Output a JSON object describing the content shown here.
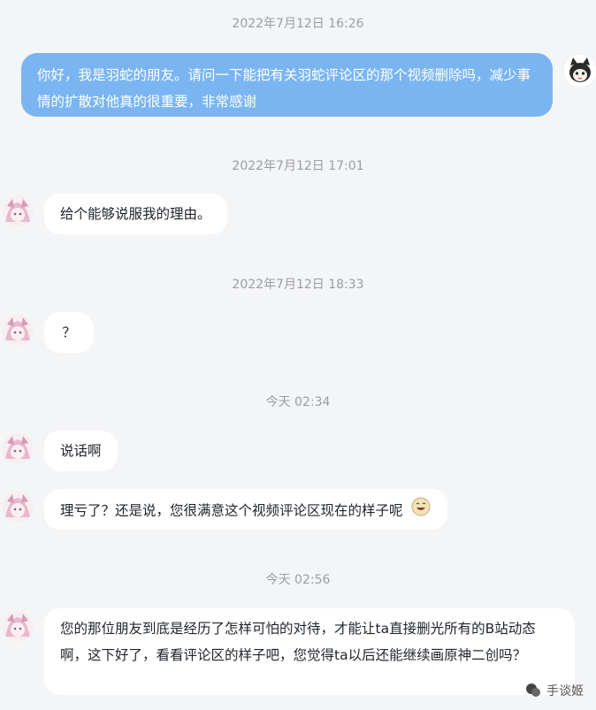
{
  "messages": [
    {
      "type": "time",
      "text": "2022年7月12日 16:26"
    },
    {
      "type": "out",
      "text": "你好，我是羽蛇的朋友。请问一下能把有关羽蛇评论区的那个视频删除吗，减少事情的扩散对他真的很重要，非常感谢"
    },
    {
      "type": "time",
      "text": "2022年7月12日 17:01"
    },
    {
      "type": "in",
      "text": "给个能够说服我的理由。"
    },
    {
      "type": "time",
      "text": "2022年7月12日 18:33"
    },
    {
      "type": "in",
      "text": "？"
    },
    {
      "type": "time",
      "text": "今天 02:34"
    },
    {
      "type": "in",
      "text": "说话啊"
    },
    {
      "type": "in",
      "text": "理亏了？还是说，您很满意这个视频评论区现在的样子呢",
      "emoji": "laughing-face-icon"
    },
    {
      "type": "time",
      "text": "今天 02:56"
    },
    {
      "type": "in",
      "text": "您的那位朋友到底是经历了怎样可怕的对待，才能让ta直接删光所有的B站动态啊，这下好了，看看评论区的样子吧，您觉得ta以后还能继续画原神二创吗？"
    }
  ],
  "watermark": {
    "text": "手谈姬"
  },
  "colors": {
    "background": "#f4f5f7",
    "outgoing_bubble": "#7ab5f2",
    "incoming_bubble": "#ffffff",
    "timestamp": "#9a9da3"
  }
}
